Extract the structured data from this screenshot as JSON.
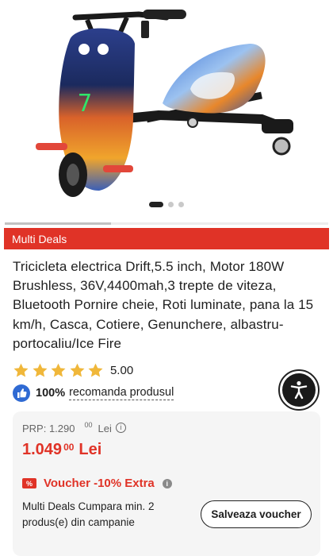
{
  "product_image": {
    "carousel": {
      "total": 3,
      "active_index": 0
    }
  },
  "store_banner": {
    "label": "Multi Deals"
  },
  "product": {
    "title": "Tricicleta electrica Drift,5.5 inch, Motor 180W Brushless, 36V,4400mah,3 trepte de viteza, Bluetooth Pornire cheie, Roti luminate, pana la 15 km/h, Casca, Cotiere, Genunchere, albastru-portocaliu/Ice Fire"
  },
  "rating": {
    "stars": 5,
    "value": "5.00",
    "star_color": "#f0b73a"
  },
  "recommend": {
    "percent": "100%",
    "text": "recomanda produsul"
  },
  "pricing": {
    "prp_label": "PRP: 1.290",
    "prp_cents": "00",
    "prp_currency": "Lei",
    "price_main": "1.049",
    "price_cents": "00",
    "price_currency": "Lei",
    "accent_color": "#e03327"
  },
  "voucher": {
    "tag": "%",
    "title": "Voucher -10% Extra",
    "description": "Multi Deals Cumpara min. 2 produs(e) din campanie",
    "button_label": "Salveaza voucher"
  },
  "icons": {
    "info": "info-icon",
    "thumbs_up": "thumbs-up-icon",
    "accessibility": "accessibility-icon"
  }
}
